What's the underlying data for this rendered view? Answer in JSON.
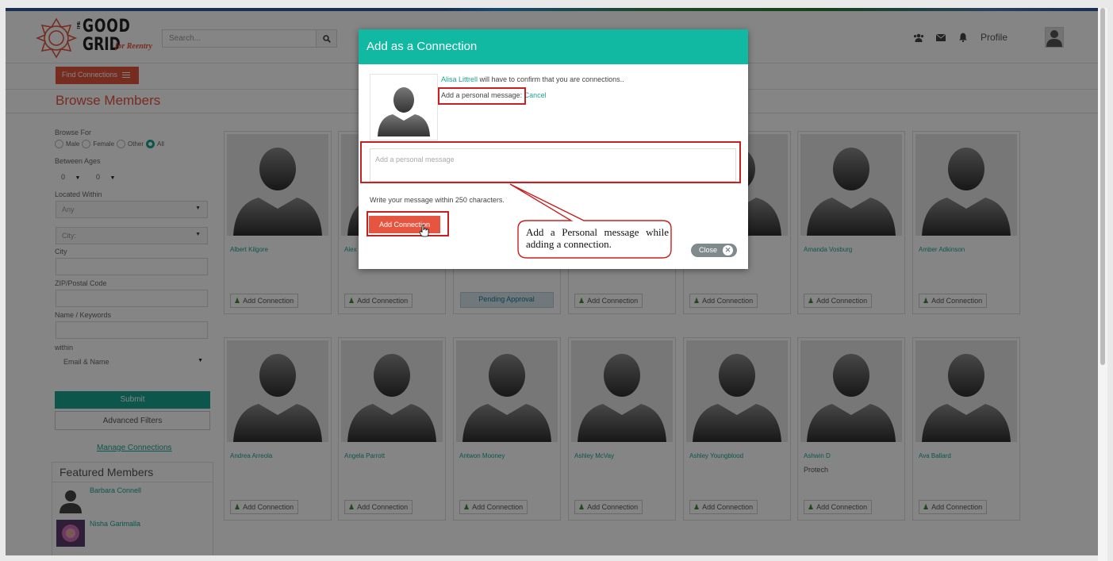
{
  "header": {
    "logo_line1": "GOOD",
    "logo_the": "THE",
    "logo_line2": "GRID",
    "logo_tag": "for Reentry",
    "search_placeholder": "Search...",
    "profile_label": "Profile",
    "icons": [
      "search-icon",
      "users-icon",
      "envelope-icon",
      "bell-icon",
      "user-icon"
    ]
  },
  "sidebar": {
    "find_connections": "Find Connections",
    "browse_title": "Browse Members",
    "browse_for_label": "Browse For",
    "gender_options": [
      "Male",
      "Female",
      "Other",
      "All"
    ],
    "gender_selected": "All",
    "between_ages_label": "Between Ages",
    "age_from": "0",
    "age_to": "0",
    "located_within_label": "Located Within",
    "located_value": "Any",
    "city_placeholder": "City:",
    "city_label": "City",
    "zip_label": "ZIP/Postal Code",
    "name_label": "Name / Keywords",
    "within_label": "within",
    "within_value": "Email & Name",
    "submit": "Submit",
    "advanced_filters": "Advanced Filters",
    "manage_connections": "Manage Connections",
    "featured_title": "Featured Members",
    "featured_members": [
      "Barbara Connell",
      "Nisha Garimalla"
    ]
  },
  "members": {
    "row1": [
      {
        "name": "Albert Kilgore",
        "button": "Add Connection"
      },
      {
        "name": "Alex",
        "button": "Add Connection"
      },
      {
        "name": "",
        "button": "Pending Approval"
      },
      {
        "name": "",
        "button": "Add Connection"
      },
      {
        "name": "",
        "button": "Add Connection"
      },
      {
        "name": "Amanda Vosburg",
        "button": "Add Connection"
      },
      {
        "name": "Amber Adkinson",
        "button": "Add Connection"
      }
    ],
    "row2": [
      {
        "name": "Andrea Arreola",
        "sub": "",
        "button": "Add Connection"
      },
      {
        "name": "Angela Parrott",
        "sub": "",
        "button": "Add Connection"
      },
      {
        "name": "Antwon Mooney",
        "sub": "",
        "button": "Add Connection"
      },
      {
        "name": "Ashley McVay",
        "sub": "",
        "button": "Add Connection"
      },
      {
        "name": "Ashley Youngblood",
        "sub": "",
        "button": "Add Connection"
      },
      {
        "name": "Ashwin D",
        "sub": "Protech",
        "button": "Add Connection"
      },
      {
        "name": "Ava Ballard",
        "sub": "",
        "button": "Add Connection"
      }
    ]
  },
  "modal": {
    "title": "Add as a Connection",
    "target_name": "Alisa Littrell",
    "confirm_text": " will have to confirm that you are connections..",
    "personal_message_label": "Add a personal message:",
    "cancel": "Cancel",
    "textarea_placeholder": "Add a personal message",
    "hint": "Write your message within 250 characters.",
    "add_button": "Add Connection",
    "close_button": "Close"
  },
  "annotation": {
    "callout_text": "Add a Personal message while adding a connection.",
    "color": "#c82020"
  },
  "colors": {
    "accent": "#e5553f",
    "teal": "#1aa592",
    "modal_header": "#11b9a2"
  }
}
